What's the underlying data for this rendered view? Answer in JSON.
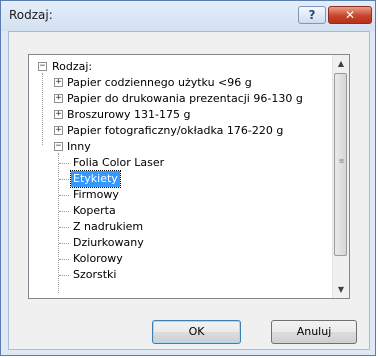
{
  "window": {
    "title": "Rodzaj:",
    "help_label": "?",
    "close_label": "✕"
  },
  "tree": {
    "root": {
      "label": "Rodzaj:",
      "toggle": "−"
    },
    "categories": [
      {
        "label": "Papier codziennego użytku <96 g",
        "toggle": "+"
      },
      {
        "label": "Papier do drukowania prezentacji 96-130 g",
        "toggle": "+"
      },
      {
        "label": "Broszurowy 131-175 g",
        "toggle": "+"
      },
      {
        "label": "Papier fotograficzny/okładka 176-220 g",
        "toggle": "+"
      },
      {
        "label": "Inny",
        "toggle": "−"
      }
    ],
    "children": [
      {
        "label": "Folia Color Laser",
        "selected": false
      },
      {
        "label": "Etykiety",
        "selected": true
      },
      {
        "label": "Firmowy",
        "selected": false
      },
      {
        "label": "Koperta",
        "selected": false
      },
      {
        "label": "Z nadrukiem",
        "selected": false
      },
      {
        "label": "Dziurkowany",
        "selected": false
      },
      {
        "label": "Kolorowy",
        "selected": false
      },
      {
        "label": "Szorstki",
        "selected": false
      }
    ]
  },
  "scrollbar": {
    "up_arrow": "▲",
    "down_arrow": "▼",
    "grip": "≡"
  },
  "buttons": {
    "ok_label": "OK",
    "cancel_label": "Anuluj"
  },
  "colors": {
    "selection": "#3399ff",
    "close": "#c7442b",
    "frame": "#dfe9f5"
  }
}
